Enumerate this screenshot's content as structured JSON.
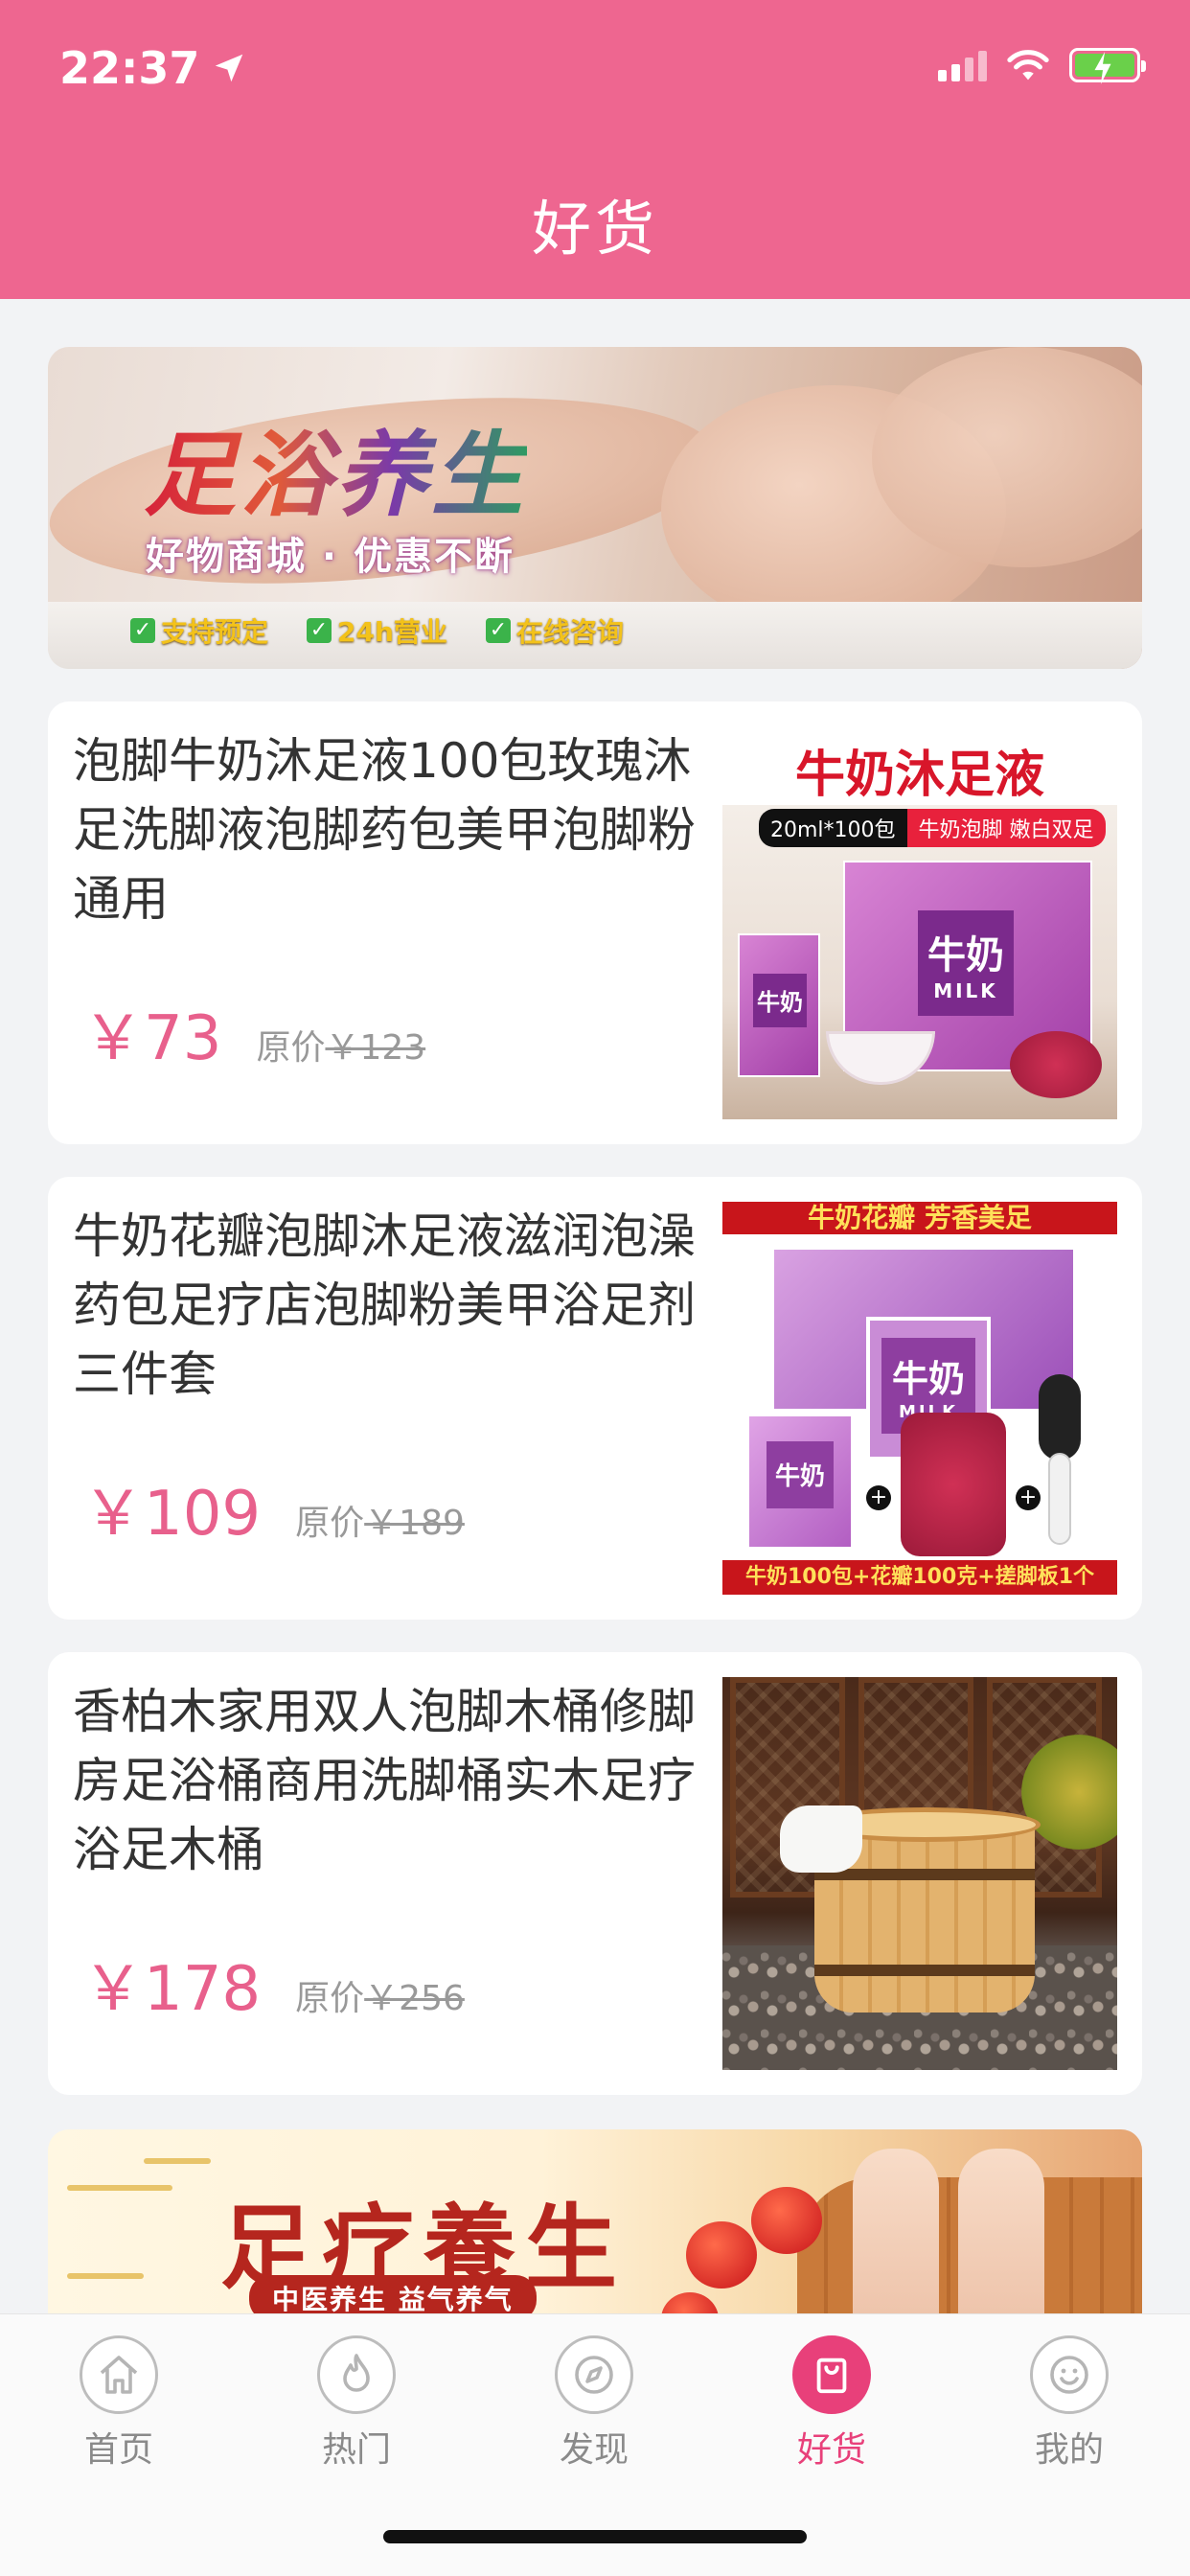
{
  "status_bar": {
    "time": "22:37"
  },
  "header": {
    "title": "好货"
  },
  "banner": {
    "title": "足浴养生",
    "subtitle": "好物商城 · 优惠不断",
    "tags": [
      "支持预定",
      "24h营业",
      "在线咨询"
    ]
  },
  "products": [
    {
      "name": "泡脚牛奶沐足液100包玫瑰沐足洗脚液泡脚药包美甲泡脚粉通用",
      "price": "￥73",
      "original_label": "原价",
      "original_price": "￥123",
      "image": {
        "headline": "牛奶沐足液",
        "pill_left": "20ml*100包",
        "pill_right": "牛奶泡脚 嫩白双足",
        "box_label": "牛奶",
        "box_sub": "MILK"
      }
    },
    {
      "name": "牛奶花瓣泡脚沐足液滋润泡澡药包足疗店泡脚粉美甲浴足剂三件套",
      "price": "￥109",
      "original_label": "原价",
      "original_price": "￥189",
      "image": {
        "top_text": "牛奶花瓣  芳香美足",
        "box_label": "牛奶",
        "box_sub": "MILK",
        "bottom_text": "牛奶100包+花瓣100克+搓脚板1个"
      }
    },
    {
      "name": "香柏木家用双人泡脚木桶修脚房足浴桶商用洗脚桶实木足疗浴足木桶",
      "price": "￥178",
      "original_label": "原价",
      "original_price": "￥256"
    }
  ],
  "banner2": {
    "title": "足疗養生",
    "subtitle": "中医养生  益气养气"
  },
  "tabbar": {
    "items": [
      {
        "label": "首页",
        "icon": "home-icon",
        "active": false
      },
      {
        "label": "热门",
        "icon": "flame-icon",
        "active": false
      },
      {
        "label": "发现",
        "icon": "compass-icon",
        "active": false
      },
      {
        "label": "好货",
        "icon": "shopping-bag-icon",
        "active": true
      },
      {
        "label": "我的",
        "icon": "smiley-icon",
        "active": false
      }
    ]
  },
  "colors": {
    "header_bg": "#ee6690",
    "accent": "#e8407a",
    "price": "#e8608c",
    "page_bg": "#f2f3f5"
  }
}
